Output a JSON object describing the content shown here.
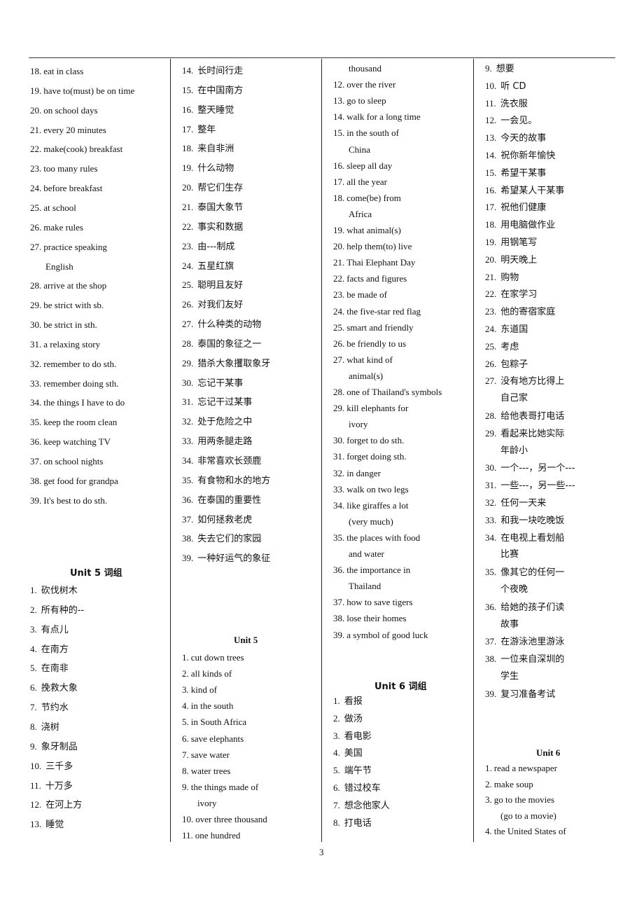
{
  "page_number": "3",
  "columns": [
    {
      "sections": [
        {
          "heading": null,
          "items": [
            {
              "n": "18.",
              "t": "eat in class"
            },
            {
              "n": "19.",
              "t": "have to(must) be on time"
            },
            {
              "n": "20.",
              "t": "on school days"
            },
            {
              "n": "21.",
              "t": "every 20 minutes"
            },
            {
              "n": "22.",
              "t": "make(cook) breakfast"
            },
            {
              "n": "23.",
              "t": "too many rules"
            },
            {
              "n": "24.",
              "t": "before breakfast"
            },
            {
              "n": "25.",
              "t": "at school"
            },
            {
              "n": "26.",
              "t": "make rules"
            },
            {
              "n": "27.",
              "t": "practice speaking",
              "cont": "English"
            },
            {
              "n": "28.",
              "t": "arrive at the shop"
            },
            {
              "n": "29.",
              "t": "be strict with sb."
            },
            {
              "n": "30.",
              "t": "be strict in sth."
            },
            {
              "n": "31.",
              "t": "a relaxing story"
            },
            {
              "n": "32.",
              "t": "remember to do sth."
            },
            {
              "n": "33.",
              "t": "remember doing sth."
            },
            {
              "n": "34.",
              "t": "the things I have to do"
            },
            {
              "n": "35.",
              "t": "keep the room clean"
            },
            {
              "n": "36.",
              "t": "keep watching TV"
            },
            {
              "n": "37.",
              "t": "on school nights"
            },
            {
              "n": "38.",
              "t": "get food for grandpa"
            },
            {
              "n": "39.",
              "t": "It's best to do sth."
            }
          ]
        },
        {
          "heading": "Unit 5 词组",
          "items": [
            {
              "n": "1.",
              "t": "砍伐树木"
            },
            {
              "n": "2.",
              "t": "所有种的--"
            },
            {
              "n": "3.",
              "t": "有点儿"
            },
            {
              "n": "4.",
              "t": "在南方"
            },
            {
              "n": "5.",
              "t": "在南非"
            },
            {
              "n": "6.",
              "t": "挽救大象"
            },
            {
              "n": "7.",
              "t": "节约水"
            },
            {
              "n": "8.",
              "t": "浇树"
            },
            {
              "n": "9.",
              "t": "象牙制品"
            },
            {
              "n": "10.",
              "t": "三千多"
            },
            {
              "n": "11.",
              "t": "十万多"
            },
            {
              "n": "12.",
              "t": "在河上方"
            },
            {
              "n": "13.",
              "t": "睡觉"
            }
          ]
        }
      ]
    },
    {
      "sections": [
        {
          "heading": null,
          "items": [
            {
              "n": "14.",
              "t": "长时间行走"
            },
            {
              "n": "15.",
              "t": "在中国南方"
            },
            {
              "n": "16.",
              "t": "整天睡觉"
            },
            {
              "n": "17.",
              "t": "整年"
            },
            {
              "n": "18.",
              "t": "来自非洲"
            },
            {
              "n": "19.",
              "t": "什么动物"
            },
            {
              "n": "20.",
              "t": "帮它们生存"
            },
            {
              "n": "21.",
              "t": "泰国大象节"
            },
            {
              "n": "22.",
              "t": "事实和数据"
            },
            {
              "n": "23.",
              "t": "由---制成"
            },
            {
              "n": "24.",
              "t": "五星红旗"
            },
            {
              "n": "25.",
              "t": "聪明且友好"
            },
            {
              "n": "26.",
              "t": "对我们友好"
            },
            {
              "n": "27.",
              "t": "什么种类的动物"
            },
            {
              "n": "28.",
              "t": "泰国的象征之一"
            },
            {
              "n": "29.",
              "t": "猎杀大象攫取象牙"
            },
            {
              "n": "30.",
              "t": "忘记干某事"
            },
            {
              "n": "31.",
              "t": "忘记干过某事"
            },
            {
              "n": "32.",
              "t": "处于危险之中"
            },
            {
              "n": "33.",
              "t": "用两条腿走路"
            },
            {
              "n": "34.",
              "t": "非常喜欢长颈鹿"
            },
            {
              "n": "35.",
              "t": "有食物和水的地方"
            },
            {
              "n": "36.",
              "t": "在泰国的重要性"
            },
            {
              "n": "37.",
              "t": "如何拯救老虎"
            },
            {
              "n": "38.",
              "t": "失去它们的家园"
            },
            {
              "n": "39.",
              "t": "一种好运气的象征"
            }
          ]
        },
        {
          "heading": "Unit 5",
          "items": [
            {
              "n": "1.",
              "t": "cut down trees"
            },
            {
              "n": "2.",
              "t": "all kinds of"
            },
            {
              "n": "3.",
              "t": "kind of"
            },
            {
              "n": "4.",
              "t": "in the south"
            },
            {
              "n": "5.",
              "t": "in South Africa"
            },
            {
              "n": "6.",
              "t": "save elephants"
            },
            {
              "n": "7.",
              "t": "save water"
            },
            {
              "n": "8.",
              "t": "water trees"
            },
            {
              "n": "9.",
              "t": "the things made of",
              "cont": "ivory"
            },
            {
              "n": "10.",
              "t": "over three thousand"
            },
            {
              "n": "11.",
              "t": "one hundred"
            }
          ]
        }
      ]
    },
    {
      "sections": [
        {
          "heading": null,
          "lead_cont": "thousand",
          "items": [
            {
              "n": "12.",
              "t": "over the river"
            },
            {
              "n": "13.",
              "t": "go to sleep"
            },
            {
              "n": "14.",
              "t": "walk for a long time"
            },
            {
              "n": "15.",
              "t": "in the south of",
              "cont": "China"
            },
            {
              "n": "16.",
              "t": "sleep all day"
            },
            {
              "n": "17.",
              "t": "all the year"
            },
            {
              "n": "18.",
              "t": "come(be) from",
              "cont": "Africa"
            },
            {
              "n": "19.",
              "t": "what animal(s)"
            },
            {
              "n": "20.",
              "t": "help them(to) live"
            },
            {
              "n": "21.",
              "t": "Thai Elephant Day"
            },
            {
              "n": "22.",
              "t": "facts and figures"
            },
            {
              "n": "23.",
              "t": "be made of"
            },
            {
              "n": "24.",
              "t": "the five-star red flag"
            },
            {
              "n": "25.",
              "t": "smart and friendly"
            },
            {
              "n": "26.",
              "t": "be friendly to us"
            },
            {
              "n": "27.",
              "t": "what kind of",
              "cont": "animal(s)"
            },
            {
              "n": "28.",
              "t": "one of Thailand's symbols"
            },
            {
              "n": "29.",
              "t": "kill elephants for",
              "cont": "ivory"
            },
            {
              "n": "30.",
              "t": "forget to do sth."
            },
            {
              "n": "31.",
              "t": "forget doing sth."
            },
            {
              "n": "32.",
              "t": "in danger"
            },
            {
              "n": "33.",
              "t": "walk on two legs"
            },
            {
              "n": "34.",
              "t": "like giraffes a lot",
              "cont": "(very much)"
            },
            {
              "n": "35.",
              "t": "the places with food",
              "cont": "and water"
            },
            {
              "n": "36.",
              "t": "the importance in",
              "cont": "Thailand"
            },
            {
              "n": "37.",
              "t": "how to save tigers"
            },
            {
              "n": "38.",
              "t": "lose their homes"
            },
            {
              "n": "39.",
              "t": "a symbol of good luck"
            }
          ]
        },
        {
          "heading": "Unit 6 词组",
          "items": [
            {
              "n": "1.",
              "t": "看报"
            },
            {
              "n": "2.",
              "t": "做汤"
            },
            {
              "n": "3.",
              "t": "看电影"
            },
            {
              "n": "4.",
              "t": "美国"
            },
            {
              "n": "5.",
              "t": "端午节"
            },
            {
              "n": "6.",
              "t": "错过校车"
            },
            {
              "n": "7.",
              "t": "想念他家人"
            },
            {
              "n": "8.",
              "t": "打电话"
            }
          ]
        }
      ]
    },
    {
      "sections": [
        {
          "heading": null,
          "items": [
            {
              "n": "9.",
              "t": "想要"
            },
            {
              "n": "10.",
              "t": "听 CD"
            },
            {
              "n": "11.",
              "t": "洗衣服"
            },
            {
              "n": "12.",
              "t": "一会见。"
            },
            {
              "n": "13.",
              "t": "今天的故事"
            },
            {
              "n": "14.",
              "t": "祝你新年愉快"
            },
            {
              "n": "15.",
              "t": "希望干某事"
            },
            {
              "n": "16.",
              "t": "希望某人干某事"
            },
            {
              "n": "17.",
              "t": "祝他们健康"
            },
            {
              "n": "18.",
              "t": "用电脑做作业"
            },
            {
              "n": "19.",
              "t": "用钢笔写"
            },
            {
              "n": "20.",
              "t": "明天晚上"
            },
            {
              "n": "21.",
              "t": "购物"
            },
            {
              "n": "22.",
              "t": "在家学习"
            },
            {
              "n": "23.",
              "t": "他的寄宿家庭"
            },
            {
              "n": "24.",
              "t": "东道国"
            },
            {
              "n": "25.",
              "t": "考虑"
            },
            {
              "n": "26.",
              "t": "包粽子"
            },
            {
              "n": "27.",
              "t": "没有地方比得上",
              "cont": "自己家"
            },
            {
              "n": "28.",
              "t": "给他表哥打电话"
            },
            {
              "n": "29.",
              "t": "看起来比她实际",
              "cont": "年龄小"
            },
            {
              "n": "30.",
              "t": "一个---，另一个---"
            },
            {
              "n": "31.",
              "t": "一些---，另一些---"
            },
            {
              "n": "32.",
              "t": "任何一天来"
            },
            {
              "n": "33.",
              "t": "和我一块吃晚饭"
            },
            {
              "n": "34.",
              "t": "在电视上看划船",
              "cont": "比赛"
            },
            {
              "n": "35.",
              "t": "像其它的任何一",
              "cont": "个夜晚"
            },
            {
              "n": "36.",
              "t": "给她的孩子们读",
              "cont": "故事"
            },
            {
              "n": "37.",
              "t": "在游泳池里游泳"
            },
            {
              "n": "38.",
              "t": "一位来自深圳的",
              "cont": "学生"
            },
            {
              "n": "39.",
              "t": "复习准备考试"
            }
          ]
        },
        {
          "heading": "Unit 6",
          "items": [
            {
              "n": "1.",
              "t": "read a newspaper"
            },
            {
              "n": "2.",
              "t": "make soup"
            },
            {
              "n": "3.",
              "t": "go to the movies",
              "cont": "(go to a movie)"
            },
            {
              "n": "4.",
              "t": "the United States of"
            }
          ]
        }
      ]
    }
  ]
}
